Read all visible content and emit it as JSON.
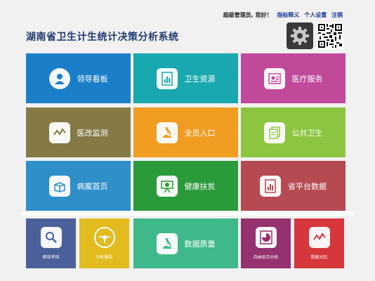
{
  "header": {
    "greeting": "超级管理员, 您好！",
    "links": [
      "指标释义",
      "个人设置",
      "注销"
    ],
    "title": "湖南省卫生计生统计决策分析系统"
  },
  "tiles": [
    {
      "label": "领导看板",
      "color": "#1a7fc8",
      "icon": "user-icon"
    },
    {
      "label": "卫生资源",
      "color": "#19a8b0",
      "icon": "report-chart-icon"
    },
    {
      "label": "医疗服务",
      "color": "#c0499a",
      "icon": "id-card-icon"
    },
    {
      "label": "医改监测",
      "color": "#857a45",
      "icon": "line-trend-icon"
    },
    {
      "label": "全员人口",
      "color": "#f19d22",
      "icon": "microscope-icon"
    },
    {
      "label": "公共卫生",
      "color": "#8cc540",
      "icon": "documents-icon"
    },
    {
      "label": "病案首页",
      "color": "#2e8fc9",
      "icon": "open-box-icon"
    },
    {
      "label": "健康扶贫",
      "color": "#2a9a3a",
      "icon": "presentation-icon"
    },
    {
      "label": "省平台数据",
      "color": "#b54a53",
      "icon": "report-chart-icon"
    }
  ],
  "bottom_tiles": [
    {
      "label": "绩效考核",
      "color": "#4b5f9a",
      "icon": "magnifier-icon"
    },
    {
      "label": "分析报告",
      "color": "#e2bb1f",
      "icon": "steering-wheel-icon"
    },
    {
      "label": "数据质量",
      "color": "#3fb98a",
      "icon": "microscope-icon"
    },
    {
      "label": "自由组合分析",
      "color": "#95316e",
      "icon": "pie-chart-icon"
    },
    {
      "label": "数据对比",
      "color": "#d6373c",
      "icon": "line-trend-icon"
    }
  ]
}
